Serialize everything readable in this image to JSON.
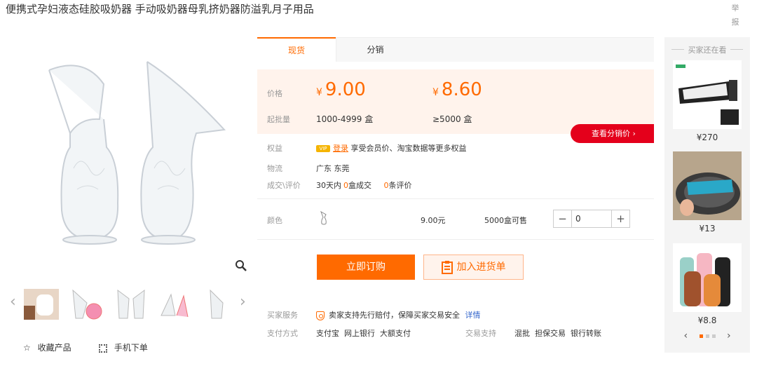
{
  "title": "便携式孕妇液态硅胶吸奶器 手动吸奶器母乳挤奶器防溢乳月子用品",
  "report": "举报",
  "actions": {
    "favorite": "收藏产品",
    "mobile_order": "手机下单"
  },
  "tabs": [
    "现货",
    "分销"
  ],
  "price_panel": {
    "price_label": "价格",
    "currency": "¥",
    "tiers": [
      {
        "price": "9.00",
        "range": "1000-4999 盒"
      },
      {
        "price": "8.60",
        "range": "≥5000 盒"
      }
    ],
    "moq_label": "起批量"
  },
  "distribution_button": "查看分销价 ›",
  "benefits": {
    "label": "权益",
    "vip": "VIP",
    "login": "登录",
    "text": "享受会员价、淘宝数据等更多权益"
  },
  "logistics": {
    "label": "物流",
    "value": "广东 东莞"
  },
  "deals": {
    "label": "成交\\评价",
    "pre": "30天内",
    "count": "0",
    "unit": "盒成交",
    "reviews": "0",
    "reviews_unit": "条评价"
  },
  "color_row": {
    "label": "颜色",
    "price": "9.00元",
    "stock": "5000盒可售",
    "qty": "0"
  },
  "buttons": {
    "buy": "立即订购",
    "cart": "加入进货单"
  },
  "service": {
    "label": "买家服务",
    "text": "卖家支持先行赔付，保障买家交易安全",
    "detail": "详情"
  },
  "payment": {
    "label": "支付方式",
    "methods": "支付宝  网上银行  大额支付",
    "trade_label": "交易支持",
    "trade": "混批  担保交易  银行转账"
  },
  "rail": {
    "title": "买家还在看",
    "items": [
      {
        "price": "¥270"
      },
      {
        "price": "¥13"
      },
      {
        "price": "¥8.8"
      }
    ]
  },
  "colors": {
    "accent": "#ff6a00",
    "red": "#e4001b",
    "price_bg": "#fff3ec"
  }
}
